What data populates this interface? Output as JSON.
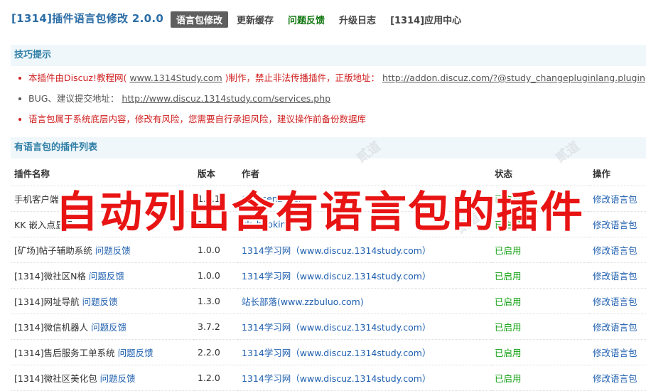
{
  "header": {
    "title": "[1314]插件语言包修改 2.0.0",
    "nav": [
      {
        "label": "语言包修改",
        "style": "active"
      },
      {
        "label": "更新缓存",
        "style": "bold"
      },
      {
        "label": "问题反馈",
        "style": "green"
      },
      {
        "label": "升级日志",
        "style": "bold"
      },
      {
        "label": "[1314]应用中心",
        "style": "bold"
      }
    ]
  },
  "tips": {
    "heading": "技巧提示",
    "line1_prefix": "本插件由Discuz!教程网(",
    "line1_site": "www.1314Study.com",
    "line1_middle": ")制作，禁止非法传播插件，正版地址：",
    "line1_url": "http://addon.discuz.com/?@study_changepluginlang.plugin",
    "line2_prefix": "BUG、建议提交地址：",
    "line2_url": "http://www.discuz.1314study.com/services.php",
    "line3": "语言包属于系统底层内容，修改有风险，您需要自行承担风险，建议操作前备份数据库"
  },
  "plugins": {
    "heading": "有语言包的插件列表",
    "columns": [
      "插件名称",
      "版本",
      "作者",
      "状态",
      "操作"
    ],
    "rows": [
      {
        "name": "手机客户端",
        "feedback": "",
        "version": "1.4.1",
        "author": "Comsenz Inc.",
        "status": "已启用",
        "action": "修改语言包"
      },
      {
        "name": "KK 嵌入点显示",
        "feedback": "",
        "version": "1.0",
        "author": "kk_hooking",
        "status": "已启用",
        "action": "修改语言包"
      },
      {
        "name": "[矿场]帖子辅助系统",
        "feedback": "问题反馈",
        "version": "1.0.0",
        "author": "1314学习网（www.discuz.1314study.com）",
        "status": "已启用",
        "action": "修改语言包"
      },
      {
        "name": "[1314]微社区N格",
        "feedback": "问题反馈",
        "version": "1.0.0",
        "author": "1314学习网（www.discuz.1314study.com）",
        "status": "已启用",
        "action": "修改语言包"
      },
      {
        "name": "[1314]网址导航",
        "feedback": "问题反馈",
        "version": "1.3.0",
        "author": "站长部落(www.zzbuluo.com)",
        "status": "已启用",
        "action": "修改语言包"
      },
      {
        "name": "[1314]微信机器人",
        "feedback": "问题反馈",
        "version": "3.7.2",
        "author": "1314学习网（www.discuz.1314study.com）",
        "status": "已启用",
        "action": "修改语言包"
      },
      {
        "name": "[1314]售后服务工单系统",
        "feedback": "问题反馈",
        "version": "2.2.0",
        "author": "1314学习网（www.discuz.1314study.com）",
        "status": "已启用",
        "action": "修改语言包"
      },
      {
        "name": "[1314]微社区美化包",
        "feedback": "问题反馈",
        "version": "1.2.0",
        "author": "1314学习网（www.discuz.1314study.com）",
        "status": "已启用",
        "action": "修改语言包"
      }
    ]
  },
  "overlay": {
    "banner": "自动列出含有语言包的插件",
    "watermark": "贰道"
  },
  "colors": {
    "accent": "#2b6da6",
    "section_bg": "#f0f7fb",
    "warning_red": "#d02020",
    "enabled_green": "#11a011",
    "banner_red": "#e81414"
  }
}
